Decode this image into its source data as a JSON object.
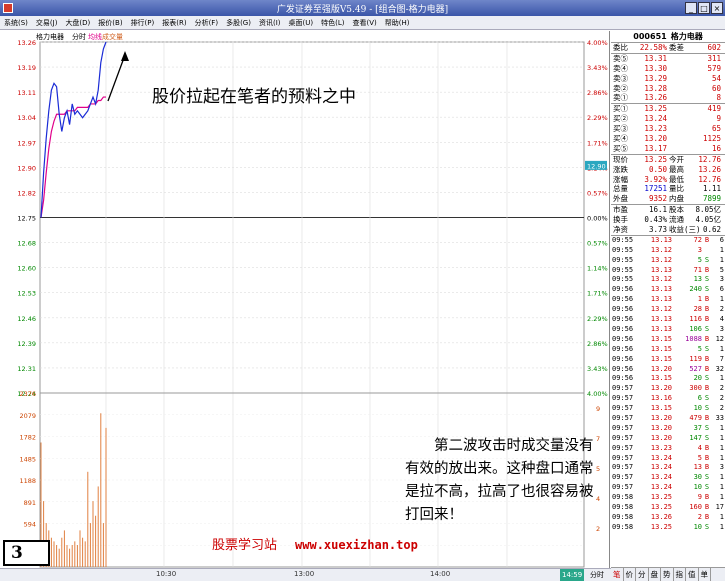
{
  "window": {
    "title": "广发证券至强版V5.49 - [组合图-格力电器]"
  },
  "menu": [
    "系统(S)",
    "交易(J)",
    "大盘(D)",
    "报价(B)",
    "排行(P)",
    "报表(R)",
    "分析(F)",
    "多股(G)",
    "资讯(I)",
    "桌面(U)",
    "特色(L)",
    "查看(V)",
    "帮助(H)"
  ],
  "chart_header": {
    "name": "格力电器",
    "mode": "分时",
    "avg_label": "均线",
    "vol_label": "成交量"
  },
  "price_axis": [
    "13.26",
    "13.19",
    "13.11",
    "13.04",
    "12.97",
    "12.90",
    "12.82",
    "12.75",
    "12.68",
    "12.60",
    "12.53",
    "12.46",
    "12.39",
    "12.31",
    "12.24"
  ],
  "pct_axis": [
    "4.00%",
    "3.43%",
    "2.86%",
    "2.29%",
    "1.71%",
    "1.14%",
    "0.57%",
    "0.00%",
    "0.57%",
    "1.14%",
    "1.71%",
    "2.29%",
    "2.86%",
    "3.43%",
    "4.00%"
  ],
  "current_price_tag": "12.90",
  "vol_axis": [
    "2376",
    "2079",
    "1782",
    "1485",
    "1188",
    "891",
    "594",
    "297"
  ],
  "vol_right_axis": [
    "9",
    "7",
    "5",
    "4",
    "2"
  ],
  "time_axis": [
    "10:30",
    "13:00",
    "14:00"
  ],
  "chart_data": {
    "type": "line",
    "title": "",
    "series": [
      {
        "name": "价格",
        "color": "#1a2bd6",
        "x": [
          0,
          1,
          2,
          3,
          4,
          5,
          6,
          7,
          8,
          9,
          10,
          11,
          12,
          13,
          14,
          15,
          16,
          17,
          18,
          19,
          20,
          21,
          22,
          23,
          24,
          25
        ],
        "values": [
          12.75,
          12.88,
          12.98,
          13.06,
          13.12,
          13.14,
          13.13,
          13.05,
          13.0,
          13.04,
          13.06,
          13.02,
          13.08,
          13.05,
          13.06,
          13.05,
          13.04,
          13.05,
          13.06,
          13.08,
          13.1,
          13.08,
          13.12,
          13.2,
          13.24,
          13.26
        ]
      },
      {
        "name": "均线",
        "color": "#e0008a",
        "x": [
          0,
          1,
          2,
          3,
          4,
          5,
          6,
          7,
          8,
          9,
          10,
          11,
          12,
          13,
          14,
          15,
          16,
          17,
          18,
          19,
          20,
          21,
          22,
          23,
          24,
          25
        ],
        "values": [
          12.75,
          12.8,
          12.88,
          12.95,
          13.0,
          13.03,
          13.05,
          13.05,
          13.05,
          13.05,
          13.06,
          13.06,
          13.06,
          13.06,
          13.07,
          13.07,
          13.07,
          13.07,
          13.07,
          13.08,
          13.08,
          13.08,
          13.09,
          13.09,
          13.1,
          13.1
        ]
      },
      {
        "name": "成交量",
        "color": "#e08040",
        "x": [
          0,
          1,
          2,
          3,
          4,
          5,
          6,
          7,
          8,
          9,
          10,
          11,
          12,
          13,
          14,
          15,
          16,
          17,
          18,
          19,
          20,
          21,
          22,
          23,
          24,
          25
        ],
        "values": [
          1700,
          900,
          600,
          500,
          400,
          350,
          300,
          250,
          400,
          500,
          300,
          250,
          300,
          350,
          300,
          500,
          400,
          350,
          1300,
          600,
          900,
          700,
          1100,
          2100,
          600,
          1900
        ]
      }
    ],
    "ylim": [
      12.24,
      13.26
    ],
    "vol_ylim": [
      0,
      2376
    ],
    "xlabel": "",
    "ylabel": ""
  },
  "quote": {
    "code": "000651",
    "name": "格力电器",
    "weibi_label": "委比",
    "weibi": "22.58%",
    "weicha_label": "委差",
    "weicha": "602",
    "asks": [
      {
        "label": "卖⑤",
        "price": "13.31",
        "vol": "311"
      },
      {
        "label": "卖④",
        "price": "13.30",
        "vol": "579"
      },
      {
        "label": "卖③",
        "price": "13.29",
        "vol": "54"
      },
      {
        "label": "卖②",
        "price": "13.28",
        "vol": "60"
      },
      {
        "label": "卖①",
        "price": "13.26",
        "vol": "8"
      }
    ],
    "bids": [
      {
        "label": "买①",
        "price": "13.25",
        "vol": "419"
      },
      {
        "label": "买②",
        "price": "13.24",
        "vol": "9"
      },
      {
        "label": "买③",
        "price": "13.23",
        "vol": "65"
      },
      {
        "label": "买④",
        "price": "13.20",
        "vol": "1125"
      },
      {
        "label": "买⑤",
        "price": "13.17",
        "vol": "16"
      }
    ],
    "stats": [
      {
        "l1": "现价",
        "v1": "13.25",
        "l2": "今开",
        "v2": "12.76",
        "c1": "red",
        "c2": "red"
      },
      {
        "l1": "涨跌",
        "v1": "0.50",
        "l2": "最高",
        "v2": "13.26",
        "c1": "red",
        "c2": "red"
      },
      {
        "l1": "涨幅",
        "v1": "3.92%",
        "l2": "最低",
        "v2": "12.76",
        "c1": "red",
        "c2": "red"
      },
      {
        "l1": "总量",
        "v1": "17251",
        "l2": "量比",
        "v2": "1.11",
        "c1": "blue",
        "c2": "black"
      },
      {
        "l1": "外盘",
        "v1": "9352",
        "l2": "内盘",
        "v2": "7899",
        "c1": "red",
        "c2": "green"
      }
    ],
    "stats2": [
      {
        "l1": "市盈",
        "v1": "16.1",
        "l2": "股本",
        "v2": "8.05亿"
      },
      {
        "l1": "换手",
        "v1": "0.43%",
        "l2": "流通",
        "v2": "4.05亿"
      },
      {
        "l1": "净资",
        "v1": "3.73",
        "l2": "收益(三)",
        "v2": "0.62"
      }
    ]
  },
  "ticks": [
    {
      "t": "09:55",
      "p": "13.13",
      "v": "72",
      "d": "B",
      "n": "6"
    },
    {
      "t": "09:55",
      "p": "13.12",
      "v": "3",
      "d": "",
      "n": "1"
    },
    {
      "t": "09:55",
      "p": "13.12",
      "v": "5",
      "d": "S",
      "n": "1"
    },
    {
      "t": "09:55",
      "p": "13.13",
      "v": "71",
      "d": "B",
      "n": "5"
    },
    {
      "t": "09:55",
      "p": "13.12",
      "v": "13",
      "d": "S",
      "n": "3"
    },
    {
      "t": "09:56",
      "p": "13.13",
      "v": "240",
      "d": "S",
      "n": "6"
    },
    {
      "t": "09:56",
      "p": "13.13",
      "v": "1",
      "d": "B",
      "n": "1"
    },
    {
      "t": "09:56",
      "p": "13.12",
      "v": "28",
      "d": "B",
      "n": "2"
    },
    {
      "t": "09:56",
      "p": "13.13",
      "v": "116",
      "d": "B",
      "n": "4"
    },
    {
      "t": "09:56",
      "p": "13.13",
      "v": "106",
      "d": "S",
      "n": "3"
    },
    {
      "t": "09:56",
      "p": "13.15",
      "v": "1088",
      "d": "B",
      "n": "12"
    },
    {
      "t": "09:56",
      "p": "13.15",
      "v": "5",
      "d": "S",
      "n": "1"
    },
    {
      "t": "09:56",
      "p": "13.15",
      "v": "119",
      "d": "B",
      "n": "7"
    },
    {
      "t": "09:56",
      "p": "13.20",
      "v": "527",
      "d": "B",
      "n": "32"
    },
    {
      "t": "09:56",
      "p": "13.15",
      "v": "20",
      "d": "S",
      "n": "1"
    },
    {
      "t": "09:57",
      "p": "13.20",
      "v": "300",
      "d": "B",
      "n": "2"
    },
    {
      "t": "09:57",
      "p": "13.16",
      "v": "6",
      "d": "S",
      "n": "2"
    },
    {
      "t": "09:57",
      "p": "13.15",
      "v": "10",
      "d": "S",
      "n": "2"
    },
    {
      "t": "09:57",
      "p": "13.20",
      "v": "479",
      "d": "B",
      "n": "33"
    },
    {
      "t": "09:57",
      "p": "13.20",
      "v": "37",
      "d": "S",
      "n": "1"
    },
    {
      "t": "09:57",
      "p": "13.20",
      "v": "147",
      "d": "S",
      "n": "1"
    },
    {
      "t": "09:57",
      "p": "13.23",
      "v": "4",
      "d": "B",
      "n": "1"
    },
    {
      "t": "09:57",
      "p": "13.24",
      "v": "5",
      "d": "B",
      "n": "1"
    },
    {
      "t": "09:57",
      "p": "13.24",
      "v": "13",
      "d": "B",
      "n": "3"
    },
    {
      "t": "09:57",
      "p": "13.24",
      "v": "30",
      "d": "S",
      "n": "1"
    },
    {
      "t": "09:57",
      "p": "13.24",
      "v": "10",
      "d": "S",
      "n": "1"
    },
    {
      "t": "09:58",
      "p": "13.25",
      "v": "9",
      "d": "B",
      "n": "1"
    },
    {
      "t": "09:58",
      "p": "13.25",
      "v": "160",
      "d": "B",
      "n": "17"
    },
    {
      "t": "09:58",
      "p": "13.26",
      "v": "2",
      "d": "B",
      "n": "1"
    },
    {
      "t": "09:58",
      "p": "13.25",
      "v": "10",
      "d": "S",
      "n": "1"
    }
  ],
  "tabs": [
    "笔",
    "价",
    "分",
    "盘",
    "势",
    "指",
    "值",
    "单"
  ],
  "status": {
    "clock": "14:59",
    "mode": "分时"
  },
  "annotations": {
    "a1": "股价拉起在笔者的预料之中",
    "a2": "第二波攻击时成交量没有有效的放出来。这种盘口通常是拉不高，拉高了也很容易被打回来！"
  },
  "watermark": {
    "site": "股票学习站",
    "url": "www.xuexizhan.top"
  },
  "figure_label": "3"
}
